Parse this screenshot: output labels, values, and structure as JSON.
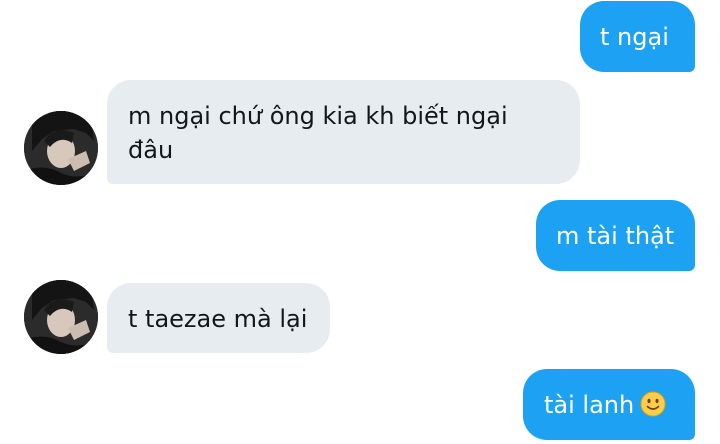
{
  "chat": {
    "messages": [
      {
        "side": "out",
        "text": "t ngại"
      },
      {
        "side": "in",
        "text": "m ngại chứ ông kia kh biết ngại đâu"
      },
      {
        "side": "out",
        "text": "m tài thật"
      },
      {
        "side": "in",
        "text": "t taezae mà lại"
      },
      {
        "side": "out",
        "text": "tài lanh",
        "emoji": "slightly-smiling-face-icon"
      }
    ]
  },
  "colors": {
    "outgoing_bubble": "#1da1f2",
    "incoming_bubble": "#e6ecf0",
    "outgoing_text": "#ffffff",
    "incoming_text": "#14171a"
  }
}
